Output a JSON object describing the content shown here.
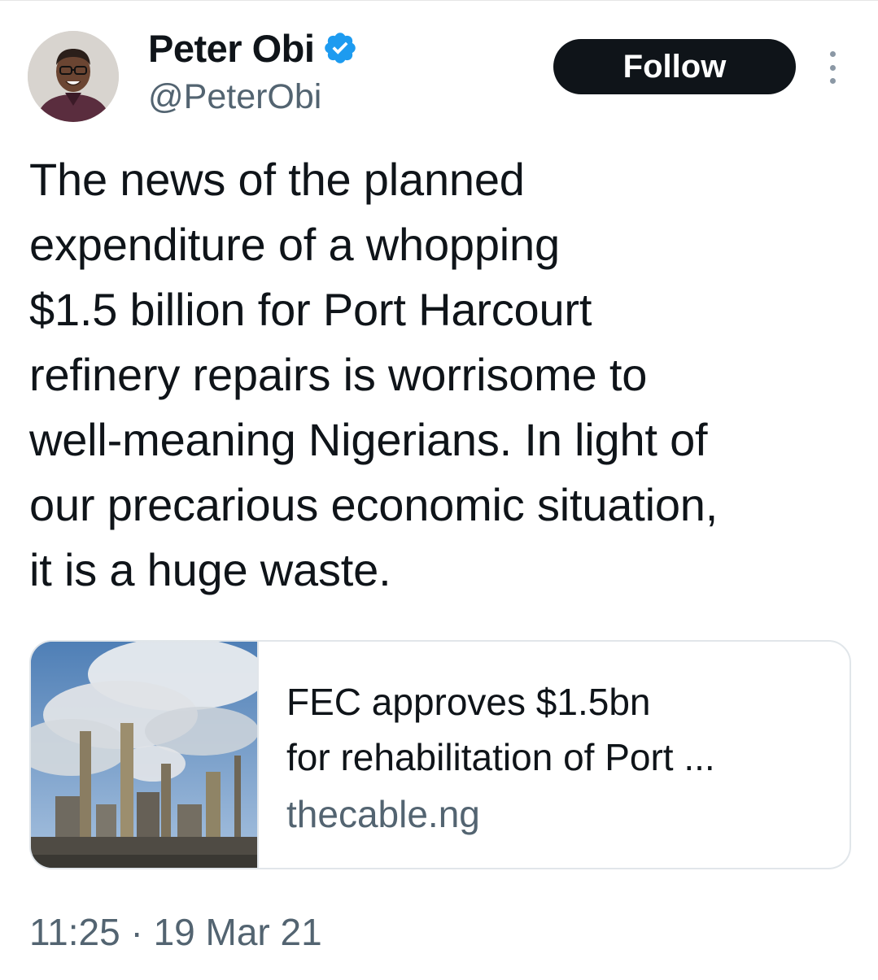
{
  "author": {
    "display_name": "Peter Obi",
    "handle": "@PeterObi",
    "verified": true,
    "avatar_icon": "profile-photo"
  },
  "actions": {
    "follow_label": "Follow",
    "more_icon": "more-vertical-icon"
  },
  "tweet": {
    "lines": [
      "The news of the planned",
      "expenditure of a whopping",
      "$1.5 billion for Port Harcourt",
      "refinery repairs is worrisome to",
      "well-meaning Nigerians. In light of",
      "our precarious economic situation,",
      "it is a huge waste."
    ]
  },
  "link_card": {
    "title_lines": [
      "FEC approves $1.5bn",
      "for rehabilitation of Port ..."
    ],
    "domain": "thecable.ng",
    "image_icon": "refinery-thumbnail"
  },
  "meta": {
    "timestamp": "11:25 · 19 Mar 21"
  },
  "colors": {
    "text": "#0f1419",
    "secondary": "#536471",
    "verified": "#1d9bf0",
    "button_bg": "#0f1419"
  }
}
